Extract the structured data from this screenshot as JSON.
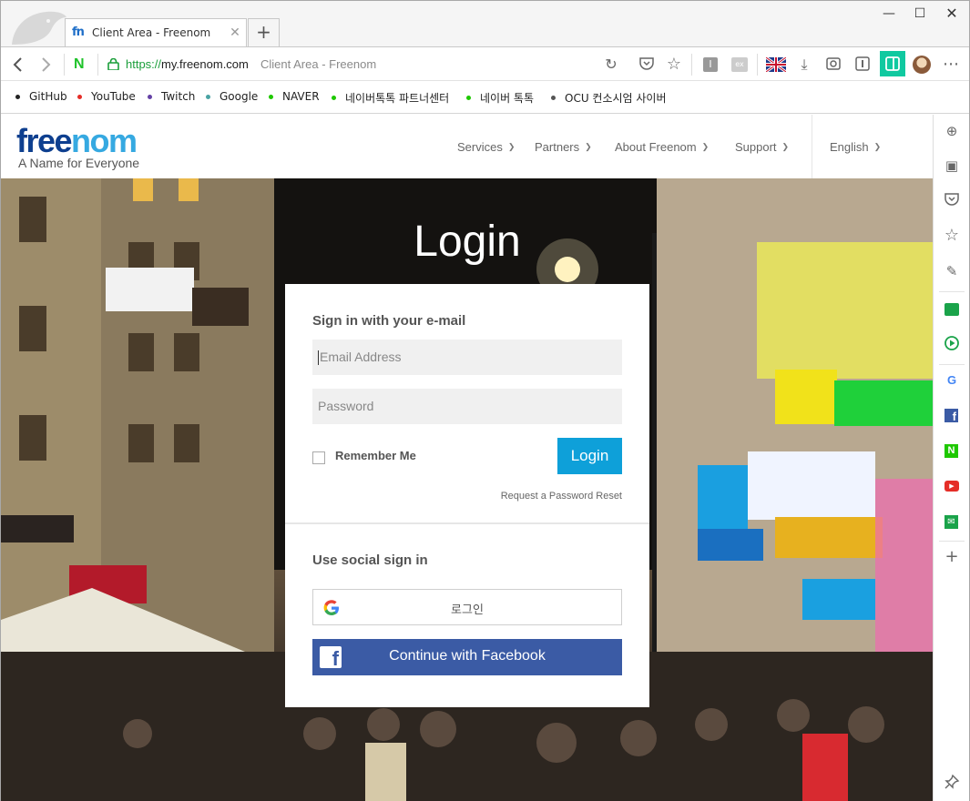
{
  "browser": {
    "tab": {
      "favicon": "fn",
      "title": "Client Area - Freenom"
    },
    "url_protocol": "https://",
    "url_host": "my.freenom.com",
    "page_title_inline": "Client Area - Freenom",
    "bookmarks": [
      {
        "label": "GitHub",
        "color": "#222222"
      },
      {
        "label": "YouTube",
        "color": "#e52d27"
      },
      {
        "label": "Twitch",
        "color": "#6441a5"
      },
      {
        "label": "Google",
        "color": "#4aa3a3"
      },
      {
        "label": "NAVER",
        "color": "#1ec800"
      },
      {
        "label": "네이버톡톡 파트너센터",
        "color": "#1ec800"
      },
      {
        "label": "네이버 톡톡",
        "color": "#1ec800"
      },
      {
        "label": "OCU 컨소시엄 사이버",
        "color": "#555555"
      }
    ]
  },
  "site": {
    "logo": {
      "part1": "free",
      "part2": "nom"
    },
    "tagline": "A Name for Everyone",
    "nav": {
      "services": "Services",
      "partners": "Partners",
      "about": "About Freenom",
      "support": "Support",
      "language": "English"
    }
  },
  "login": {
    "title": "Login",
    "email_heading": "Sign in with your e-mail",
    "email_placeholder": "Email Address",
    "password_placeholder": "Password",
    "remember": "Remember Me",
    "login_button": "Login",
    "reset_link": "Request a Password Reset",
    "social_heading": "Use social sign in",
    "google_label": "로그인",
    "facebook_label": "Continue with Facebook"
  },
  "colors": {
    "accent": "#0ea0d9",
    "facebook": "#3b5ba5",
    "logo_dark": "#0e3f8f",
    "logo_light": "#36a9e1"
  }
}
